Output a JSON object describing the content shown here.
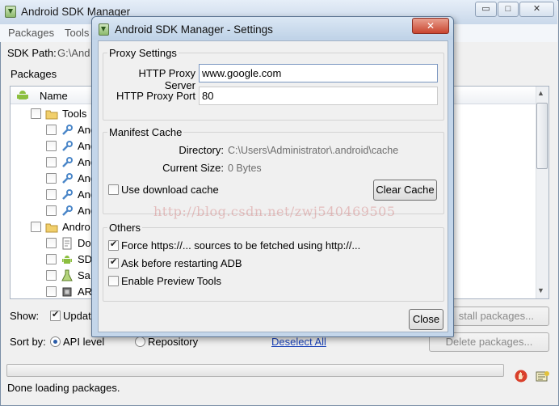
{
  "main": {
    "title": "Android SDK Manager",
    "caption": {
      "minimize": "▭",
      "maximize": "□",
      "close": "✕"
    },
    "menu": [
      "Packages",
      "Tools"
    ],
    "sdk_path_label": "SDK Path:",
    "sdk_path_value": "G:\\And",
    "packages_label": "Packages",
    "column_name": "Name",
    "rows": [
      {
        "label": "Tools",
        "indent": 0,
        "icon": "folder-icon"
      },
      {
        "label": "And",
        "indent": 1,
        "icon": "wrench-icon"
      },
      {
        "label": "And",
        "indent": 1,
        "icon": "wrench-icon"
      },
      {
        "label": "And",
        "indent": 1,
        "icon": "wrench-icon"
      },
      {
        "label": "And",
        "indent": 1,
        "icon": "wrench-icon"
      },
      {
        "label": "And",
        "indent": 1,
        "icon": "wrench-icon"
      },
      {
        "label": "And",
        "indent": 1,
        "icon": "wrench-icon"
      },
      {
        "label": "Andro",
        "indent": 0,
        "icon": "folder-icon"
      },
      {
        "label": "Do",
        "indent": 1,
        "icon": "document-icon"
      },
      {
        "label": "SD",
        "indent": 1,
        "icon": "android-icon"
      },
      {
        "label": "Sa",
        "indent": 1,
        "icon": "flask-icon"
      },
      {
        "label": "AR",
        "indent": 1,
        "icon": "chip-icon"
      }
    ],
    "show_label": "Show:",
    "show_updates_label": "Updat",
    "sort_label": "Sort by:",
    "sort_api_label": "API level",
    "sort_repo_label": "Repository",
    "deselect_all": "Deselect All",
    "install_button": "Install packages...",
    "install_button_visible": "stall packages...",
    "delete_button": "Delete packages...",
    "status": "Done loading packages."
  },
  "dialog": {
    "title": "Android SDK Manager - Settings",
    "close_glyph": "✕",
    "proxy": {
      "group_title": "Proxy Settings",
      "server_label": "HTTP Proxy Server",
      "server_value": "www.google.com",
      "port_label": "HTTP Proxy Port",
      "port_value": "80"
    },
    "cache": {
      "group_title": "Manifest Cache",
      "directory_label": "Directory:",
      "directory_value": "C:\\Users\\Administrator\\.android\\cache",
      "size_label": "Current Size:",
      "size_value": "0 Bytes",
      "use_cache_label": "Use download cache",
      "use_cache_checked": false,
      "clear_button": "Clear Cache"
    },
    "others": {
      "group_title": "Others",
      "options": [
        {
          "label": "Force https://... sources to be fetched using http://...",
          "checked": true
        },
        {
          "label": "Ask before restarting ADB",
          "checked": true
        },
        {
          "label": "Enable Preview Tools",
          "checked": false
        }
      ]
    },
    "close_button": "Close"
  },
  "watermark": "http://blog.csdn.net/zwj540469505"
}
